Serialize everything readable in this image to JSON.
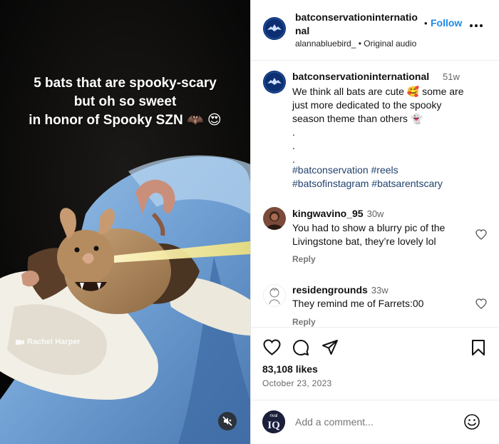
{
  "media": {
    "overlay_lines": [
      "5 bats that are spooky-scary",
      "but oh so sweet",
      "in honor of Spooky SZN 🦇 😍"
    ],
    "credit": "Rachel Harper",
    "mute_icon": "speaker-muted-icon"
  },
  "header": {
    "username": "batconservationinternational",
    "dot": "•",
    "follow_label": "Follow",
    "subline": "alannabluebird_ • Original audio"
  },
  "caption": {
    "username": "batconservationinternational",
    "time": "51w",
    "lines": [
      "We think all bats are cute 🥰 some are",
      "just more dedicated to the spooky",
      "season theme than others 👻",
      ".",
      ".",
      "."
    ],
    "hashtags": [
      "#batconservation #reels",
      "#batsofinstagram #batsarentscary"
    ]
  },
  "comments": [
    {
      "username": "kingwavino_95",
      "time": "30w",
      "lines": [
        "You had to show a blurry pic of the",
        "Livingstone bat, they’re lovely lol"
      ],
      "reply_label": "Reply"
    },
    {
      "username": "residengrounds",
      "time": "33w",
      "lines": [
        "They remind me of Farrets:00"
      ],
      "reply_label": "Reply"
    }
  ],
  "actions": {
    "icons": [
      "heart-icon",
      "comment-icon",
      "share-icon",
      "bookmark-icon"
    ],
    "likes": "83,108 likes",
    "date": "October 23, 2023"
  },
  "add_comment": {
    "placeholder": "Add a comment...",
    "avatar_text": "IQ",
    "avatar_top_text": "rival"
  },
  "colors": {
    "follow_blue": "#1d8ae5",
    "hashtag_blue": "#22426e",
    "brand_navy": "#0c2f72"
  }
}
